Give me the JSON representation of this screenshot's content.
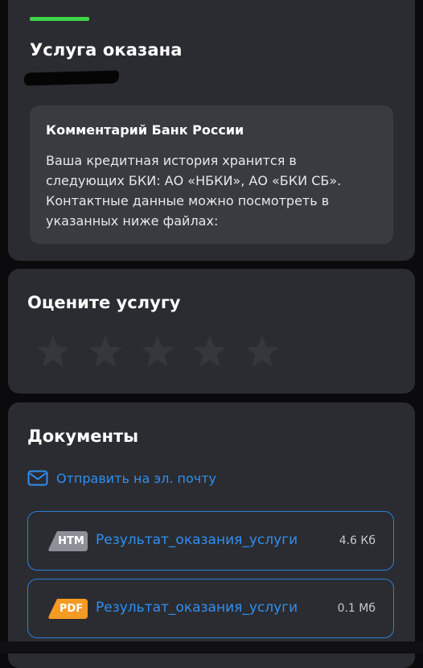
{
  "status": {
    "title": "Услуга оказана",
    "accent_color": "#3fd54a",
    "comment": {
      "title": "Комментарий Банк России",
      "text": "Ваша кредитная история хранится в следующих БКИ: АО «НБКИ», АО «БКИ СБ». Контактные данные можно посмотреть в указанных ниже файлах:"
    }
  },
  "rating": {
    "title": "Оцените услугу",
    "stars_total": 5,
    "stars_selected": 0
  },
  "documents": {
    "title": "Документы",
    "email_link": "Отправить на эл. почту",
    "link_color": "#2f8ff0",
    "items": [
      {
        "badge": "HTM",
        "badge_color": "#8e9097",
        "name": "Результат_оказания_услуги",
        "size": "4.6 Кб"
      },
      {
        "badge": "PDF",
        "badge_color": "#f59a23",
        "name": "Результат_оказания_услуги",
        "size": "0.1 Мб"
      }
    ]
  }
}
